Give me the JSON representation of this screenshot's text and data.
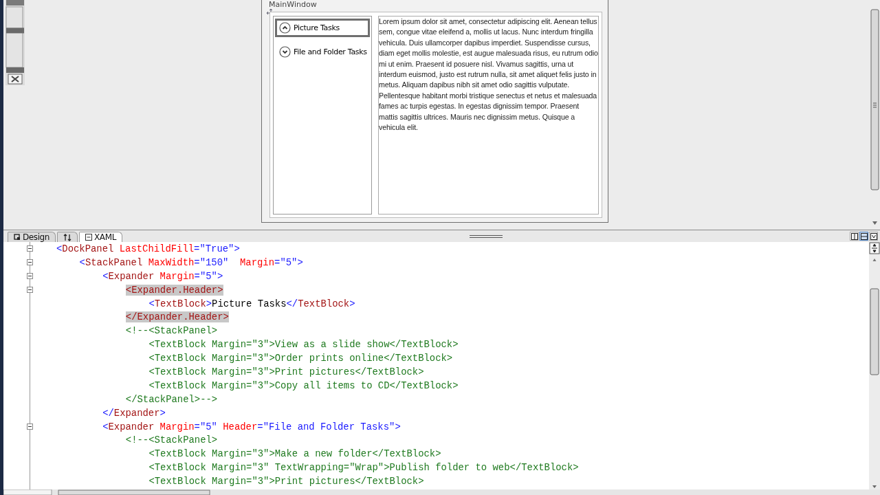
{
  "designer": {
    "zoom_slider": {
      "level": 0.62
    },
    "window": {
      "title": "MainWindow"
    },
    "expanders": [
      {
        "header": "Picture Tasks",
        "expanded": true,
        "selected": true
      },
      {
        "header": "File and Folder Tasks",
        "expanded": false,
        "selected": false
      }
    ],
    "content_text": "Lorem ipsum dolor sit amet, consectetur adipiscing elit. Aenean tellus sem, congue vitae eleifend a, mollis ut lacus. Nunc interdum fringilla vehicula. Duis ullamcorper dapibus imperdiet. Suspendisse cursus, diam eget mollis molestie, est augue malesuada risus, eu rutrum odio mi ut enim. Praesent id posuere nisl. Vivamus sagittis, urna ut interdum euismod, justo est rutrum nulla, sit amet aliquet felis justo in metus. Aliquam dapibus nibh sit amet odio sagittis vulputate. Pellentesque habitant morbi tristique senectus et netus et malesuada fames ac turpis egestas. In egestas dignissim tempor. Praesent mattis sagittis ultrices. Mauris nec dignissim metus. Quisque a vehicula elit."
  },
  "view_tabs": [
    {
      "kind": "design",
      "label": "Design",
      "selected": false
    },
    {
      "kind": "swap",
      "selected": false
    },
    {
      "kind": "xaml",
      "label": "XAML",
      "selected": true
    }
  ],
  "layout_buttons": [
    {
      "kind": "vsplit",
      "selected": false
    },
    {
      "kind": "hsplit",
      "selected": true
    },
    {
      "kind": "swap",
      "selected": false
    }
  ],
  "code": [
    {
      "expanded": true,
      "line": [
        {
          "kind": "punct",
          "text": "<"
        },
        {
          "kind": "element",
          "text": "DockPanel"
        },
        {
          "kind": "attribute",
          "text": " LastChildFill"
        },
        {
          "kind": "punct",
          "text": "="
        },
        {
          "kind": "value",
          "text": "\"True\""
        },
        {
          "kind": "punct",
          "text": ">"
        }
      ],
      "children": [
        {
          "expanded": true,
          "line": [
            {
              "kind": "punct",
              "text": "<"
            },
            {
              "kind": "element",
              "text": "StackPanel"
            },
            {
              "kind": "attribute",
              "text": " MaxWidth"
            },
            {
              "kind": "punct",
              "text": "="
            },
            {
              "kind": "value",
              "text": "\"150\""
            },
            {
              "kind": "attribute",
              "text": "  Margin"
            },
            {
              "kind": "punct",
              "text": "="
            },
            {
              "kind": "value",
              "text": "\"5\""
            },
            {
              "kind": "punct",
              "text": ">"
            }
          ],
          "children": [
            {
              "expanded": true,
              "line": [
                {
                  "kind": "punct",
                  "text": "<"
                },
                {
                  "kind": "element",
                  "text": "Expander"
                },
                {
                  "kind": "attribute",
                  "text": " Margin"
                },
                {
                  "kind": "punct",
                  "text": "="
                },
                {
                  "kind": "value",
                  "text": "\"5\""
                },
                {
                  "kind": "punct",
                  "text": ">"
                }
              ],
              "children": [
                {
                  "expanded": true,
                  "line": [
                    {
                      "kind": "match",
                      "text": "<Expander.Header>"
                    }
                  ],
                  "children": [
                    {
                      "line": [
                        {
                          "kind": "punct",
                          "text": "<"
                        },
                        {
                          "kind": "element",
                          "text": "TextBlock"
                        },
                        {
                          "kind": "punct",
                          "text": ">"
                        },
                        {
                          "kind": "text",
                          "text": "Picture Tasks"
                        },
                        {
                          "kind": "punct",
                          "text": "</"
                        },
                        {
                          "kind": "element",
                          "text": "TextBlock"
                        },
                        {
                          "kind": "punct",
                          "text": ">"
                        }
                      ]
                    }
                  ],
                  "end": [
                    {
                      "kind": "match",
                      "text": "</Expander.Header>"
                    }
                  ]
                },
                {
                  "line": [
                    {
                      "kind": "comment",
                      "text": "<!--<StackPanel>"
                    }
                  ],
                  "children": [
                    {
                      "line": [
                        {
                          "kind": "comment",
                          "text": "<TextBlock Margin=\"3\">View as a slide show</TextBlock>"
                        }
                      ]
                    },
                    {
                      "line": [
                        {
                          "kind": "comment",
                          "text": "<TextBlock Margin=\"3\">Order prints online</TextBlock>"
                        }
                      ]
                    },
                    {
                      "line": [
                        {
                          "kind": "comment",
                          "text": "<TextBlock Margin=\"3\">Print pictures</TextBlock>"
                        }
                      ]
                    },
                    {
                      "line": [
                        {
                          "kind": "comment",
                          "text": "<TextBlock Margin=\"3\">Copy all items to CD</TextBlock>"
                        }
                      ]
                    }
                  ],
                  "end": [
                    {
                      "kind": "comment",
                      "text": "</StackPanel>-->"
                    }
                  ]
                }
              ],
              "end": [
                {
                  "kind": "punct",
                  "text": "</"
                },
                {
                  "kind": "element",
                  "text": "Expander"
                },
                {
                  "kind": "punct",
                  "text": ">"
                }
              ]
            },
            {
              "expanded": true,
              "line": [
                {
                  "kind": "punct",
                  "text": "<"
                },
                {
                  "kind": "element",
                  "text": "Expander"
                },
                {
                  "kind": "attribute",
                  "text": " Margin"
                },
                {
                  "kind": "punct",
                  "text": "="
                },
                {
                  "kind": "value",
                  "text": "\"5\""
                },
                {
                  "kind": "attribute",
                  "text": " Header"
                },
                {
                  "kind": "punct",
                  "text": "="
                },
                {
                  "kind": "value",
                  "text": "\"File and Folder Tasks\""
                },
                {
                  "kind": "punct",
                  "text": ">"
                }
              ],
              "children": [
                {
                  "line": [
                    {
                      "kind": "comment",
                      "text": "<!--<StackPanel>"
                    }
                  ],
                  "children": [
                    {
                      "line": [
                        {
                          "kind": "comment",
                          "text": "<TextBlock Margin=\"3\">Make a new folder</TextBlock>"
                        }
                      ]
                    },
                    {
                      "line": [
                        {
                          "kind": "comment",
                          "text": "<TextBlock Margin=\"3\" TextWrapping=\"Wrap\">Publish folder to web</TextBlock>"
                        }
                      ]
                    },
                    {
                      "line": [
                        {
                          "kind": "comment",
                          "text": "<TextBlock Margin=\"3\">Print pictures</TextBlock>"
                        }
                      ]
                    }
                  ]
                }
              ]
            }
          ]
        }
      ]
    }
  ]
}
